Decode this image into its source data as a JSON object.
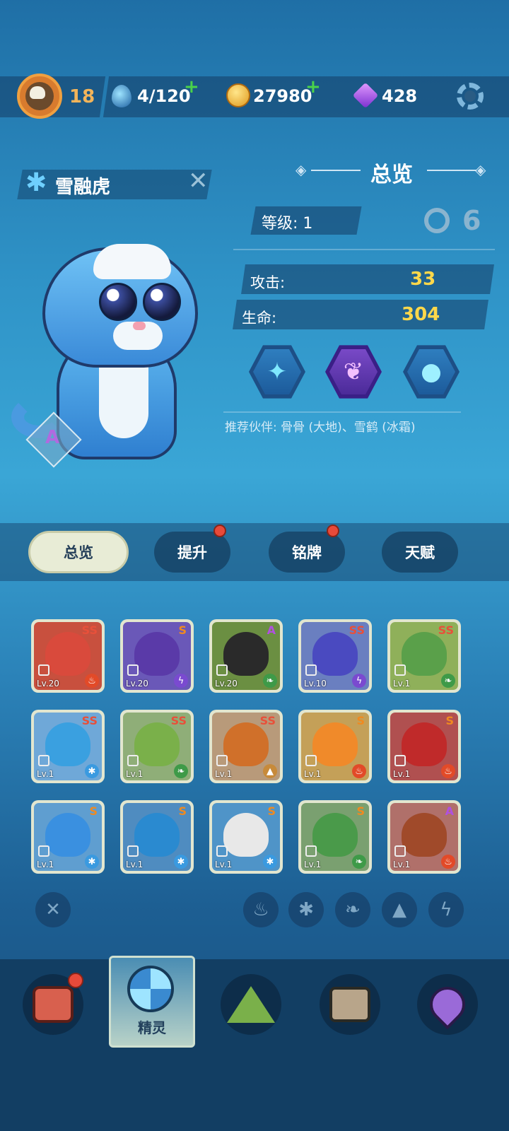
{
  "topbar": {
    "player_level": "18",
    "stamina": "4/120",
    "coins": "27980",
    "gems": "428",
    "plus": "+",
    "icons": [
      "player-avatar-icon",
      "water-drop-icon",
      "coin-icon",
      "gem-icon",
      "settings-gear-icon"
    ]
  },
  "pet": {
    "name": "雪融虎",
    "rank": "A",
    "element_icon": "snowflake-icon"
  },
  "overview": {
    "title": "总览",
    "level_label": "等级: 1",
    "attack_label": "攻击:",
    "attack_value": "33",
    "hp_label": "生命:",
    "hp_value": "304",
    "skills": [
      "sparkle-skill-icon",
      "twin-drops-skill-icon",
      "ice-drop-skill-icon"
    ],
    "recommend": "推荐伙伴: 骨骨 (大地)、雪鹤 (冰霜)"
  },
  "tabs": [
    {
      "label": "总览",
      "active": true,
      "badge": false
    },
    {
      "label": "提升",
      "active": false,
      "badge": true
    },
    {
      "label": "铭牌",
      "active": false,
      "badge": true
    },
    {
      "label": "天赋",
      "active": false,
      "badge": false
    }
  ],
  "pets": [
    {
      "rank": "SS",
      "level": "Lv.20",
      "element": "fire",
      "color": "#d94a3c",
      "bg": "#c8503e"
    },
    {
      "rank": "S",
      "level": "Lv.20",
      "element": "thunder",
      "color": "#5a3aa8",
      "bg": "#6a58b8"
    },
    {
      "rank": "A",
      "level": "Lv.20",
      "element": "wood",
      "color": "#2a2a2a",
      "bg": "#6b8f42"
    },
    {
      "rank": "SS",
      "level": "Lv.10",
      "element": "thunder",
      "color": "#4a4ac0",
      "bg": "#6a7fc0"
    },
    {
      "rank": "SS",
      "level": "Lv.1",
      "element": "wood",
      "color": "#5aa04a",
      "bg": "#8fb05a"
    },
    {
      "rank": "SS",
      "level": "Lv.1",
      "element": "ice",
      "color": "#3aa0e0",
      "bg": "#6fa8d8"
    },
    {
      "rank": "SS",
      "level": "Lv.1",
      "element": "wood",
      "color": "#7ab04a",
      "bg": "#8fae78"
    },
    {
      "rank": "SS",
      "level": "Lv.1",
      "element": "earth",
      "color": "#d0702a",
      "bg": "#b89a7a"
    },
    {
      "rank": "S",
      "level": "Lv.1",
      "element": "fire",
      "color": "#f08a2a",
      "bg": "#c4a058"
    },
    {
      "rank": "S",
      "level": "Lv.1",
      "element": "fire",
      "color": "#c02a2a",
      "bg": "#b05050"
    },
    {
      "rank": "S",
      "level": "Lv.1",
      "element": "ice",
      "color": "#3a90e0",
      "bg": "#5f9ed0"
    },
    {
      "rank": "S",
      "level": "Lv.1",
      "element": "ice",
      "color": "#2a8ad0",
      "bg": "#4f8cc0"
    },
    {
      "rank": "S",
      "level": "Lv.1",
      "element": "ice",
      "color": "#e8e8e8",
      "bg": "#4f94c8"
    },
    {
      "rank": "S",
      "level": "Lv.1",
      "element": "wood",
      "color": "#4a9a4a",
      "bg": "#7aa070"
    },
    {
      "rank": "A",
      "level": "Lv.1",
      "element": "fire",
      "color": "#a04a2a",
      "bg": "#b0706a"
    }
  ],
  "filters": [
    "clear-filter-icon",
    "fire-filter-icon",
    "ice-filter-icon",
    "wood-filter-icon",
    "earth-filter-icon",
    "thunder-filter-icon"
  ],
  "nav": {
    "active_label": "精灵",
    "items": [
      "shop-nav-icon",
      "spirit-nav-icon",
      "adventure-nav-icon",
      "chest-nav-icon",
      "map-nav-icon"
    ]
  },
  "colors": {
    "fire": "#e24a28",
    "ice": "#3a9ae0",
    "wood": "#3e9a48",
    "earth": "#c78a3a",
    "thunder": "#7a4ad0",
    "rank_ss": "#e8503a",
    "rank_s": "#f08a20",
    "rank_a": "#b050e0"
  }
}
